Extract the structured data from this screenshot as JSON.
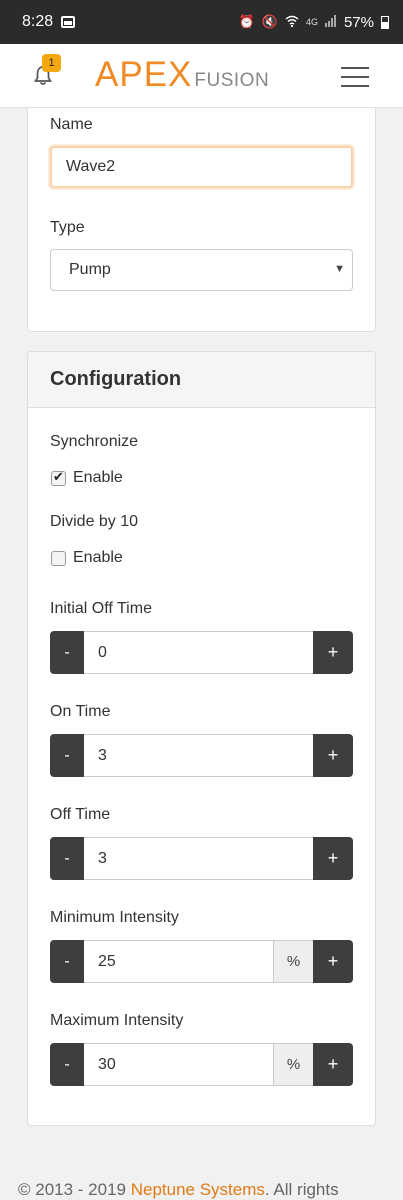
{
  "status_bar": {
    "time": "8:28",
    "network": "4G",
    "battery": "57%"
  },
  "header": {
    "notification_count": "1",
    "logo_main": "APEX",
    "logo_sub": "FUSION",
    "brand_color": "#f08a24"
  },
  "form": {
    "name_label": "Name",
    "name_value": "Wave2",
    "type_label": "Type",
    "type_value": "Pump"
  },
  "configuration": {
    "heading": "Configuration",
    "synchronize": {
      "label": "Synchronize",
      "checkbox_label": "Enable",
      "checked": true
    },
    "divide_by_10": {
      "label": "Divide by 10",
      "checkbox_label": "Enable",
      "checked": false
    },
    "initial_off_time": {
      "label": "Initial Off Time",
      "value": "0"
    },
    "on_time": {
      "label": "On Time",
      "value": "3"
    },
    "off_time": {
      "label": "Off Time",
      "value": "3"
    },
    "minimum_intensity": {
      "label": "Minimum Intensity",
      "value": "25",
      "unit": "%"
    },
    "maximum_intensity": {
      "label": "Maximum Intensity",
      "value": "30",
      "unit": "%"
    },
    "minus_label": "-",
    "plus_label": "+"
  },
  "footer": {
    "prefix": "© 2013 - 2019 ",
    "link": "Neptune Systems",
    "suffix": ". All rights"
  }
}
